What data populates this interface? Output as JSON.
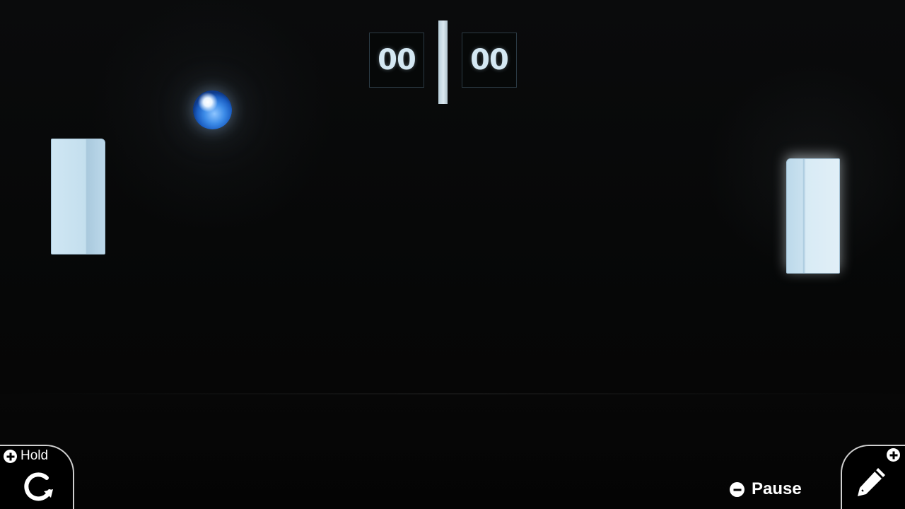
{
  "scoreboard": {
    "left_score": "00",
    "right_score": "00"
  },
  "controls": {
    "hold_label": "Hold",
    "hold_button_icon": "plus-circle-icon",
    "rotate_icon": "rotate-clockwise-icon",
    "pause_label": "Pause",
    "pause_button_icon": "minus-circle-icon",
    "edit_icon": "pencil-icon",
    "edit_button_icon": "plus-circle-icon"
  },
  "colors": {
    "background": "#050606",
    "paddle": "#cfe6f3",
    "score_text": "#d4e8f3",
    "ball": "#3d8ce8"
  }
}
